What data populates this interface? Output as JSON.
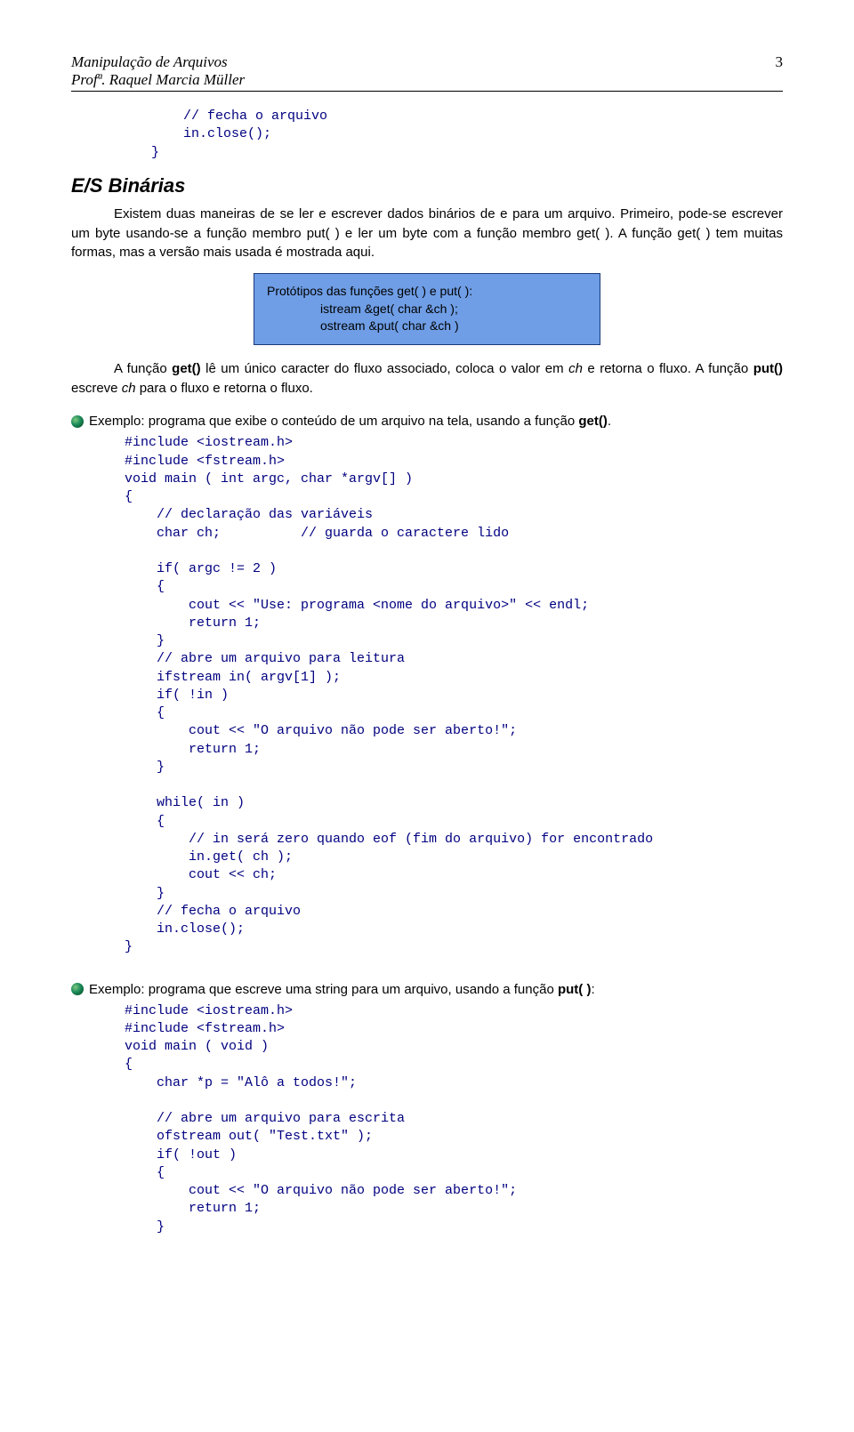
{
  "header": {
    "title": "Manipulação de Arquivos",
    "subtitle": "Profª. Raquel Marcia Müller",
    "page_number": "3"
  },
  "code_top": "    // fecha o arquivo\n    in.close();\n}",
  "section_heading": "E/S Binárias",
  "para1": "Existem duas maneiras de se ler e escrever dados binários de e para um arquivo. Primeiro, pode-se escrever um byte usando-se a função membro put( ) e ler um byte com a função membro get( ). A função get( ) tem muitas formas, mas a versão mais usada é mostrada aqui.",
  "proto_box": {
    "line1": "Protótipos das funções get( ) e put( ):",
    "line2": "istream &get( char &ch );",
    "line3": "ostream &put( char &ch )"
  },
  "para2_prefix": "A função ",
  "para2_get": "get()",
  "para2_mid1": " lê um único caracter do fluxo associado, coloca o valor em ",
  "para2_ch1": "ch",
  "para2_mid2": " e retorna o fluxo. A função ",
  "para2_put": "put()",
  "para2_mid3": " escreve ",
  "para2_ch2": "ch",
  "para2_suffix": " para o fluxo e retorna o fluxo.",
  "example1_text": "Exemplo: programa que exibe o conteúdo de um arquivo na tela, usando a função ",
  "example1_fn": "get()",
  "example1_period": ".",
  "code1": "#include <iostream.h>\n#include <fstream.h>\nvoid main ( int argc, char *argv[] )\n{\n    // declaração das variáveis\n    char ch;          // guarda o caractere lido\n\n    if( argc != 2 )\n    {\n        cout << \"Use: programa <nome do arquivo>\" << endl;\n        return 1;\n    }\n    // abre um arquivo para leitura\n    ifstream in( argv[1] );\n    if( !in )\n    {\n        cout << \"O arquivo não pode ser aberto!\";\n        return 1;\n    }\n\n    while( in )\n    {\n        // in será zero quando eof (fim do arquivo) for encontrado\n        in.get( ch );\n        cout << ch;\n    }\n    // fecha o arquivo\n    in.close();\n}",
  "example2_text": "Exemplo: programa que escreve uma string para um arquivo, usando a função ",
  "example2_fn": "put( )",
  "example2_colon": ":",
  "code2": "#include <iostream.h>\n#include <fstream.h>\nvoid main ( void )\n{\n    char *p = \"Alô a todos!\";\n\n    // abre um arquivo para escrita\n    ofstream out( \"Test.txt\" );\n    if( !out )\n    {\n        cout << \"O arquivo não pode ser aberto!\";\n        return 1;\n    }"
}
